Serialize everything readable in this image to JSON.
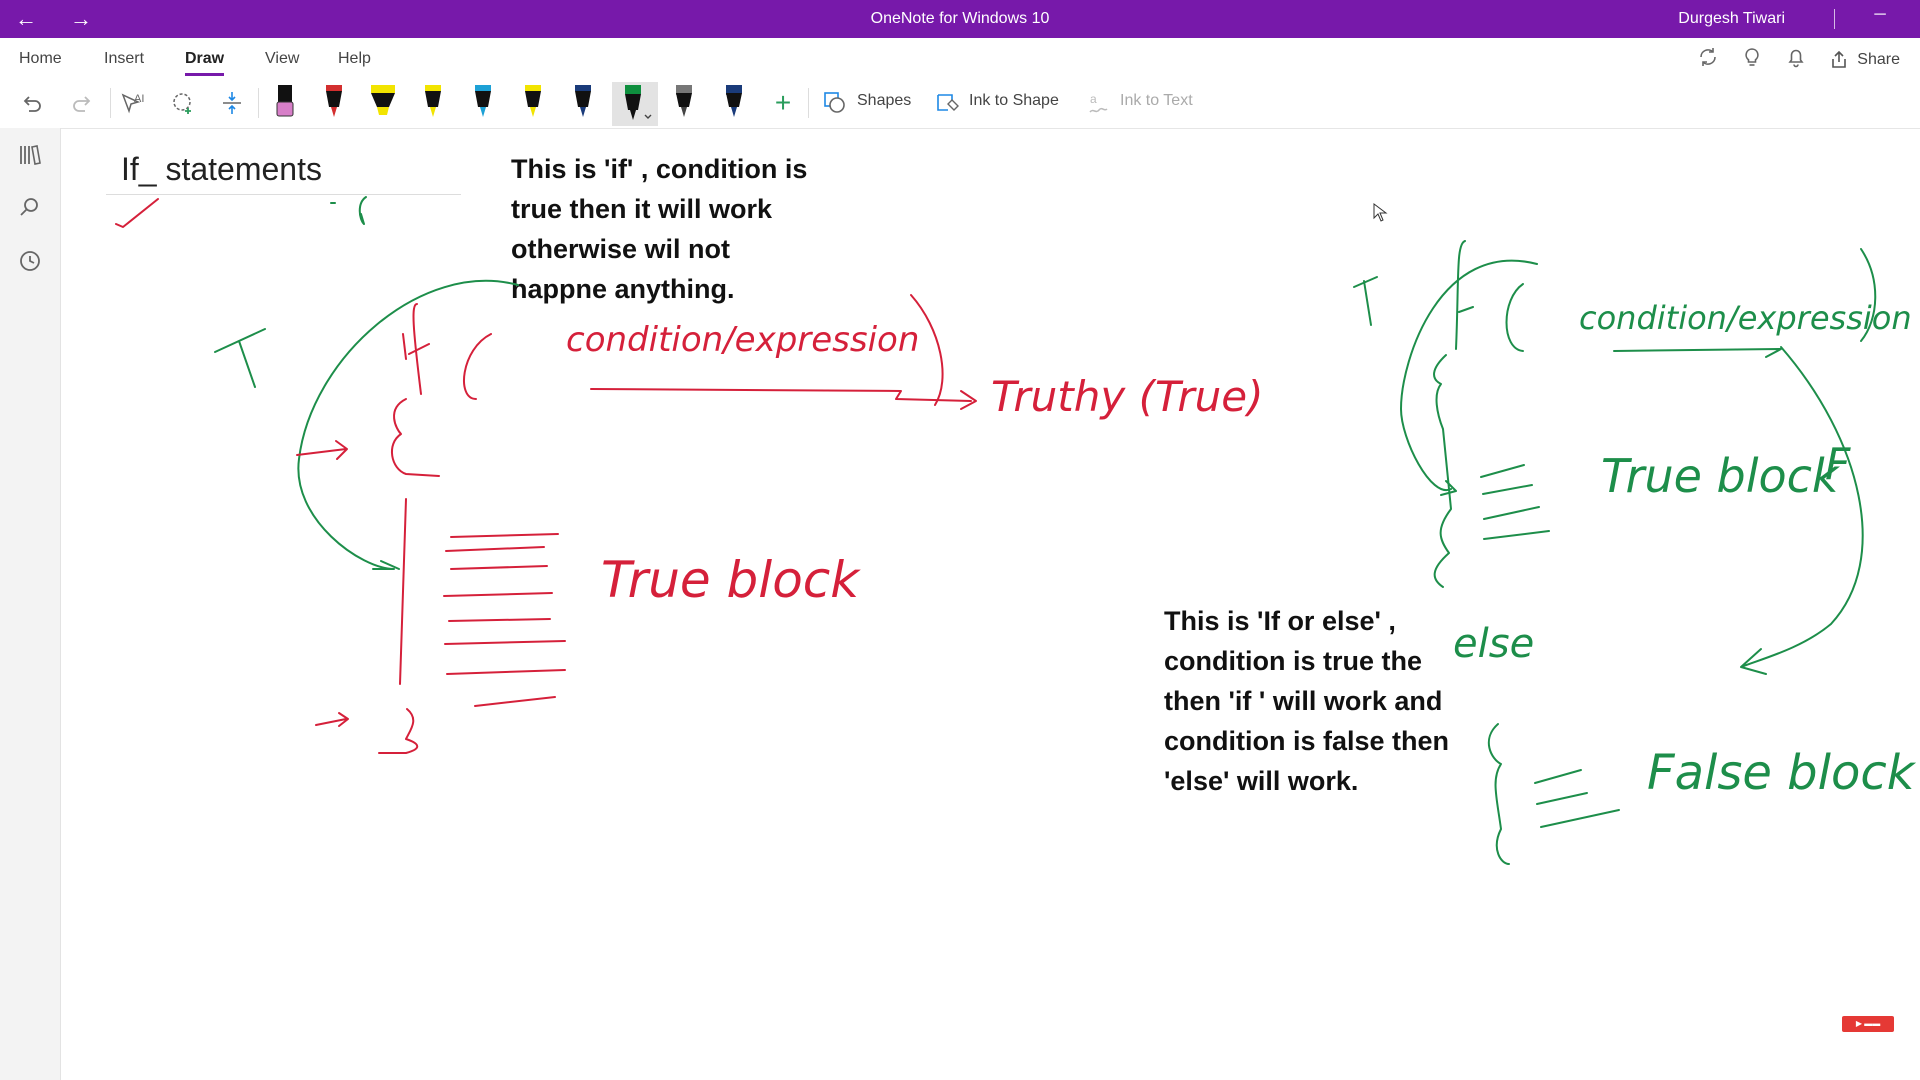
{
  "window": {
    "title": "OneNote for Windows 10",
    "user": "Durgesh Tiwari",
    "back_icon": "←",
    "forward_icon": "→",
    "minimize_icon": "─"
  },
  "menu": {
    "tabs": [
      "Home",
      "Insert",
      "Draw",
      "View",
      "Help"
    ],
    "active_tab": "Draw",
    "share_label": "Share"
  },
  "toolbar": {
    "shapes_label": "Shapes",
    "ink_to_shape_label": "Ink to Shape",
    "ink_to_text_label": "Ink to Text",
    "add_pen_icon": "+",
    "pen_colors": [
      "#111111",
      "#d32f2f",
      "#f2e400",
      "#f2e400",
      "#1da1d6",
      "#f2e400",
      "#1a3b7a",
      "#0e8f3e",
      "#444444",
      "#1a3b7a"
    ],
    "selected_pen_index": 7
  },
  "page": {
    "title": "If_ statements",
    "note_if": [
      "This is 'if' , condition is",
      "true then it will work",
      "otherwise wil not",
      "happne anything."
    ],
    "note_if_else": [
      "This is 'If or else' ,",
      "condition is true the",
      "then 'if ' will work and",
      "condition is false then",
      "'else' will work."
    ]
  },
  "ink": {
    "left_color": "#d5203a",
    "green_color": "#1d8e4a",
    "red_words": [
      "condition/expression",
      "Truthy (True)",
      "True block"
    ],
    "green_words": [
      "condition/expression",
      "True block",
      "else",
      "False block"
    ]
  },
  "colors": {
    "accent": "#7719aa"
  }
}
